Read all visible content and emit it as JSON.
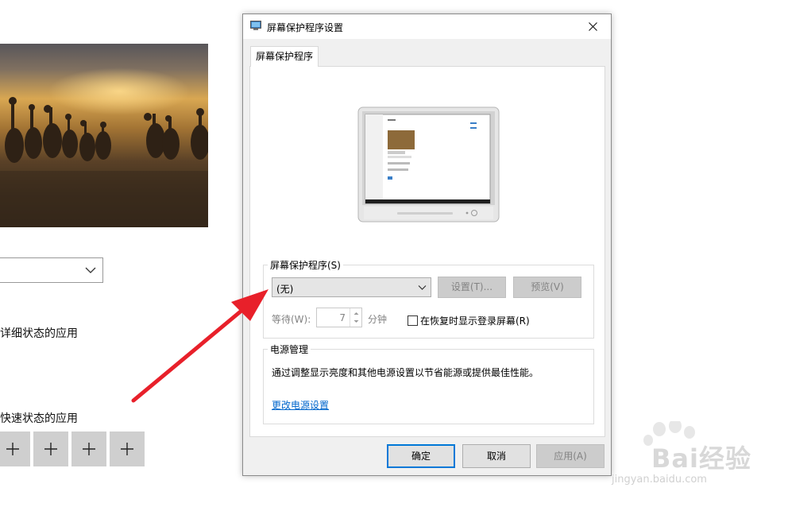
{
  "background_page": {
    "label_detailed": "详细状态的应用",
    "label_quick": "快速状态的应用"
  },
  "dialog": {
    "title": "屏幕保护程序设置",
    "tab_label": "屏幕保护程序",
    "screensaver_group": {
      "legend": "屏幕保护程序(S)",
      "combo_value": "(无)",
      "settings_button": "设置(T)...",
      "preview_button": "预览(V)",
      "wait_label": "等待(W):",
      "wait_value": "7",
      "minutes_label": "分钟",
      "checkbox_label": "在恢复时显示登录屏幕(R)",
      "checkbox_checked": false
    },
    "power_group": {
      "legend": "电源管理",
      "description": "通过调整显示亮度和其他电源设置以节省能源或提供最佳性能。",
      "link": "更改电源设置"
    },
    "buttons": {
      "ok": "确定",
      "cancel": "取消",
      "apply": "应用(A)"
    }
  },
  "watermark": {
    "text": "Bai经验",
    "url": "jingyan.baidu.com"
  },
  "colors": {
    "arrow": "#e8202a",
    "link": "#0066cc",
    "focus_border": "#0078d7"
  }
}
